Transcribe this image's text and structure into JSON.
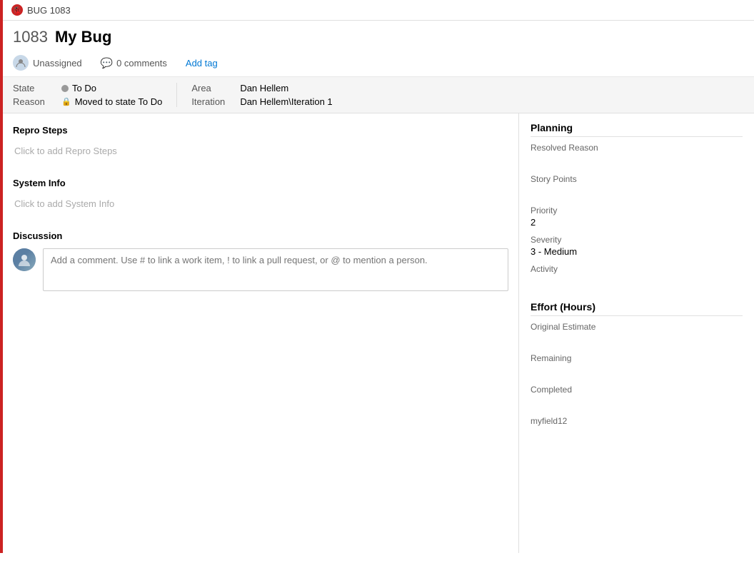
{
  "topbar": {
    "icon_label": "BUG",
    "title": "BUG 1083"
  },
  "workitem": {
    "id": "1083",
    "title": "My Bug",
    "assignee": "Unassigned",
    "comments_count": "0 comments",
    "add_tag_label": "Add tag"
  },
  "fields": {
    "state_label": "State",
    "state_value": "To Do",
    "reason_label": "Reason",
    "reason_value": "Moved to state To Do",
    "area_label": "Area",
    "area_value": "Dan Hellem",
    "iteration_label": "Iteration",
    "iteration_value": "Dan Hellem\\Iteration 1"
  },
  "sections": {
    "repro_steps": {
      "title": "Repro Steps",
      "placeholder": "Click to add Repro Steps"
    },
    "system_info": {
      "title": "System Info",
      "placeholder": "Click to add System Info"
    },
    "discussion": {
      "title": "Discussion",
      "comment_placeholder": "Add a comment. Use # to link a work item, ! to link a pull request, or @ to mention a person."
    }
  },
  "planning": {
    "title": "Planning",
    "resolved_reason_label": "Resolved Reason",
    "resolved_reason_value": "",
    "story_points_label": "Story Points",
    "story_points_value": "",
    "priority_label": "Priority",
    "priority_value": "2",
    "severity_label": "Severity",
    "severity_value": "3 - Medium",
    "activity_label": "Activity",
    "activity_value": ""
  },
  "effort": {
    "title": "Effort (Hours)",
    "original_estimate_label": "Original Estimate",
    "original_estimate_value": "",
    "remaining_label": "Remaining",
    "remaining_value": "",
    "completed_label": "Completed",
    "completed_value": "",
    "myfield12_label": "myfield12",
    "myfield12_value": ""
  },
  "colors": {
    "accent_red": "#cc2222",
    "link_blue": "#0078d4"
  }
}
